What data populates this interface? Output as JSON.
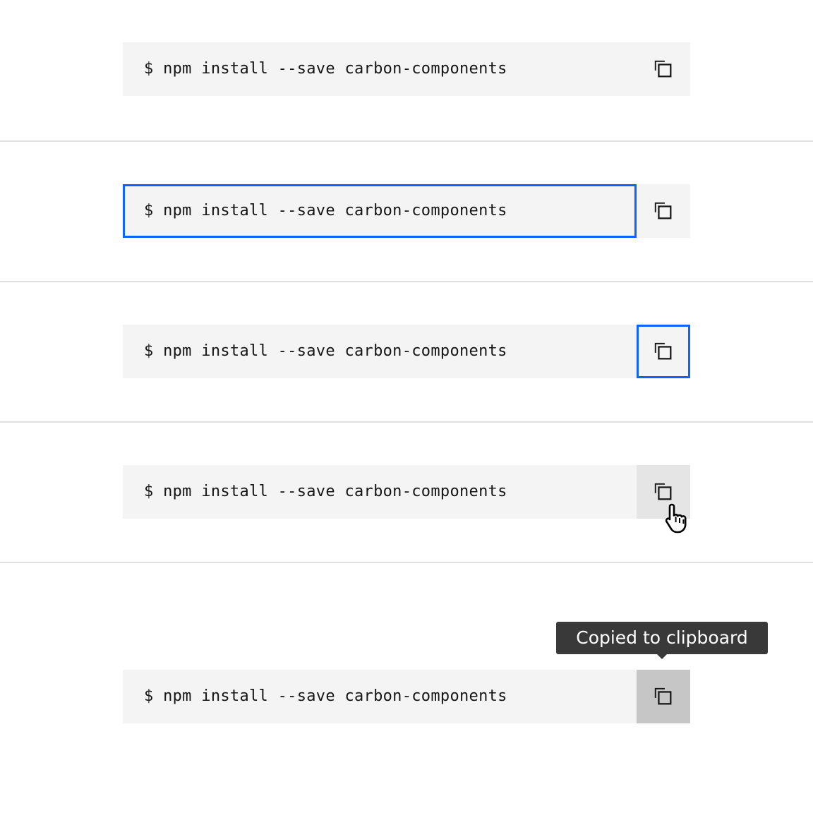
{
  "snippets": [
    {
      "state": "default",
      "code": "$ npm install --save carbon-components",
      "copy_icon": "copy-icon"
    },
    {
      "state": "code-focus",
      "code": "$ npm install --save carbon-components",
      "copy_icon": "copy-icon"
    },
    {
      "state": "button-focus",
      "code": "$ npm install --save carbon-components",
      "copy_icon": "copy-icon"
    },
    {
      "state": "button-hover",
      "code": "$ npm install --save carbon-components",
      "copy_icon": "copy-icon",
      "cursor_icon": "pointer-hand-icon"
    },
    {
      "state": "button-active",
      "code": "$ npm install --save carbon-components",
      "copy_icon": "copy-icon"
    }
  ],
  "tooltip": {
    "text": "Copied to clipboard"
  },
  "colors": {
    "snippet_bg": "#f4f4f4",
    "focus": "#0f62fe",
    "hover": "#e5e5e5",
    "active": "#c6c6c6",
    "tooltip_bg": "#393939",
    "divider": "#e0e0e0"
  }
}
